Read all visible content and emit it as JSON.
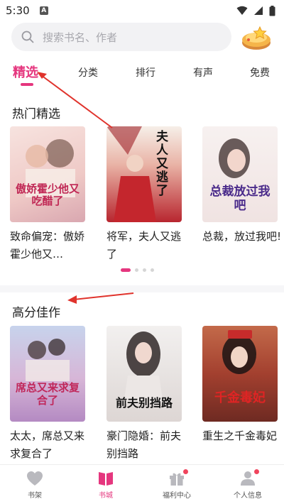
{
  "status": {
    "time": "5:30",
    "notif_letter": "A"
  },
  "search": {
    "placeholder": "搜索书名、作者"
  },
  "tabs": [
    {
      "label": "精选",
      "active": true
    },
    {
      "label": "分类",
      "active": false
    },
    {
      "label": "排行",
      "active": false
    },
    {
      "label": "有声",
      "active": false
    },
    {
      "label": "免费",
      "active": false
    }
  ],
  "sections": [
    {
      "title": "热门精选",
      "books": [
        {
          "title": "致命偏宠：傲娇霍少他又…",
          "cover_text": "傲娇霍少他又吃醋了",
          "cover_color": "#f3d9d6"
        },
        {
          "title": "将军，夫人又逃了",
          "cover_text": "夫人又逃了",
          "cover_color": "#c9333a"
        },
        {
          "title": "总裁，放过我吧!",
          "cover_text": "总裁放过我吧",
          "cover_color": "#f1e7e6"
        }
      ]
    },
    {
      "title": "高分佳作",
      "books": [
        {
          "title": "太太，席总又来求复合了",
          "cover_text": "席总又来求复合了",
          "cover_color": "#c9b9d9"
        },
        {
          "title": "豪门隐婚：前夫别挡路",
          "cover_text": "前夫别挡路",
          "cover_color": "#e9e6e6"
        },
        {
          "title": "重生之千金毒妃",
          "cover_text": "千金毒妃",
          "cover_color": "#b7553c"
        }
      ]
    }
  ],
  "bottom_nav": [
    {
      "label": "书架",
      "icon": "heart-icon",
      "active": false
    },
    {
      "label": "书城",
      "icon": "book-icon",
      "active": true
    },
    {
      "label": "福利中心",
      "icon": "gift-icon",
      "active": false
    },
    {
      "label": "个人信息",
      "icon": "person-icon",
      "active": false
    }
  ],
  "colors": {
    "accent": "#e5367e",
    "arrow": "#e0332c"
  }
}
